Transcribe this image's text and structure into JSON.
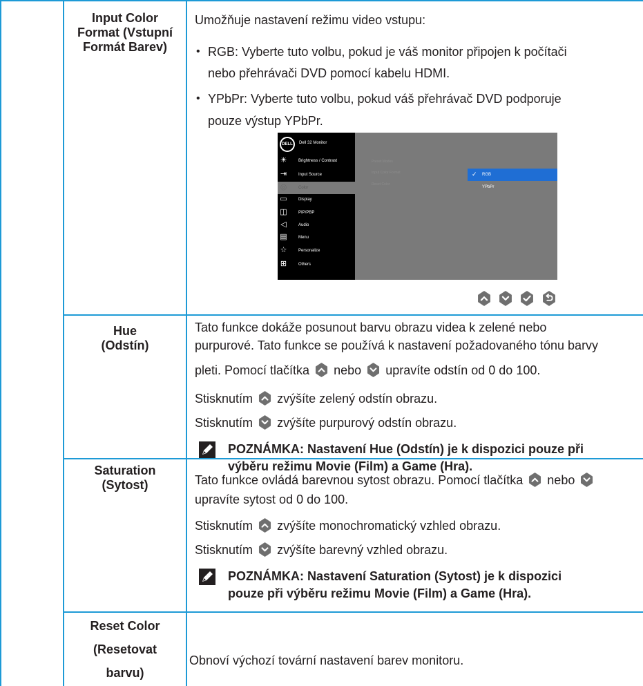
{
  "colors": {
    "rule": "#1d9ad6",
    "text": "#231f20",
    "button": "#6f6f6f",
    "osd_bg": "#7a7a7a",
    "osd_selected": "#1f6ed4"
  },
  "input_color_format": {
    "label": [
      "Input Color",
      "Format (Vstupní",
      "Formát Barev)"
    ],
    "intro": "Umožňuje nastavení režimu video vstupu:",
    "rgb": {
      "term": "RGB",
      "line1": ": Vyberte tuto volbu, pokud je váš monitor připojen k počítači",
      "line2": "nebo přehrávači DVD pomocí kabelu HDMI."
    },
    "ypbpr": {
      "term": "YPbPr",
      "line1": ": Vyberte tuto volbu, pokud váš přehrávač DVD podporuje",
      "line2": "pouze výstup YPbPr."
    }
  },
  "osd": {
    "logo": "DELL",
    "title": "Dell 32 Monitor",
    "menu": [
      {
        "label": "Brightness / Contrast",
        "icon": "sun-icon",
        "glyph": "☀"
      },
      {
        "label": "Input Source",
        "icon": "input-source-icon",
        "glyph": "⇥"
      },
      {
        "label": "Color",
        "icon": "color-icon",
        "glyph": "◎",
        "active": true
      },
      {
        "label": "Display",
        "icon": "display-icon",
        "glyph": "▭"
      },
      {
        "label": "PIP/PBP",
        "icon": "pip-icon",
        "glyph": "◫"
      },
      {
        "label": "Audio",
        "icon": "speaker-icon",
        "glyph": "◁"
      },
      {
        "label": "Menu",
        "icon": "menu-icon",
        "glyph": "▤"
      },
      {
        "label": "Personalize",
        "icon": "star-icon",
        "glyph": "☆"
      },
      {
        "label": "Others",
        "icon": "others-icon",
        "glyph": "⊞"
      }
    ],
    "middle": [
      "Preset Modes",
      "Input Color Format",
      "Reset Color"
    ],
    "options": [
      {
        "label": "RGB",
        "selected": true
      },
      {
        "label": "YPbPr",
        "selected": false
      }
    ],
    "buttons": [
      "up-button",
      "down-button",
      "check-button",
      "back-button"
    ]
  },
  "hue": {
    "label": [
      "Hue",
      "(Odstín)"
    ],
    "line1": "Tato funkce dokáže posunout barvu obrazu videa k zelené nebo",
    "line2": "purpurové. Tato funkce se používá k nastavení požadovaného tónu barvy",
    "line3_a": "pleti. Pomocí tlačítka",
    "line3_b": "nebo",
    "line3_c": "upravíte odstín od 0 do 100.",
    "press_up_a": "Stisknutím",
    "press_up_b": "zvýšíte zelený odstín obrazu.",
    "press_down_a": "Stisknutím",
    "press_down_b": "zvýšíte purpurový odstín obrazu.",
    "note_line1": "POZNÁMKA: Nastavení Hue (Odstín) je k dispozici pouze při",
    "note_line2": "výběru režimu Movie (Film) a Game (Hra)."
  },
  "saturation": {
    "label": [
      "Saturation",
      "(Sytost)"
    ],
    "line1_a": "Tato funkce ovládá barevnou sytost obrazu. Pomocí tlačítka",
    "line1_b": "nebo",
    "line2": "upravíte sytost od 0 do 100.",
    "press_up_a": "Stisknutím",
    "press_up_b": "zvýšíte monochromatický vzhled obrazu.",
    "press_down_a": "Stisknutím",
    "press_down_b": "zvýšíte barevný vzhled obrazu.",
    "note_line1": "POZNÁMKA: Nastavení Saturation (Sytost) je k dispozici",
    "note_line2": "pouze při výběru režimu Movie (Film) a Game (Hra)."
  },
  "reset_color": {
    "label": [
      "Reset Color",
      "(Resetovat",
      "barvu)"
    ],
    "text": "Obnoví výchozí tovární nastavení barev monitoru."
  }
}
